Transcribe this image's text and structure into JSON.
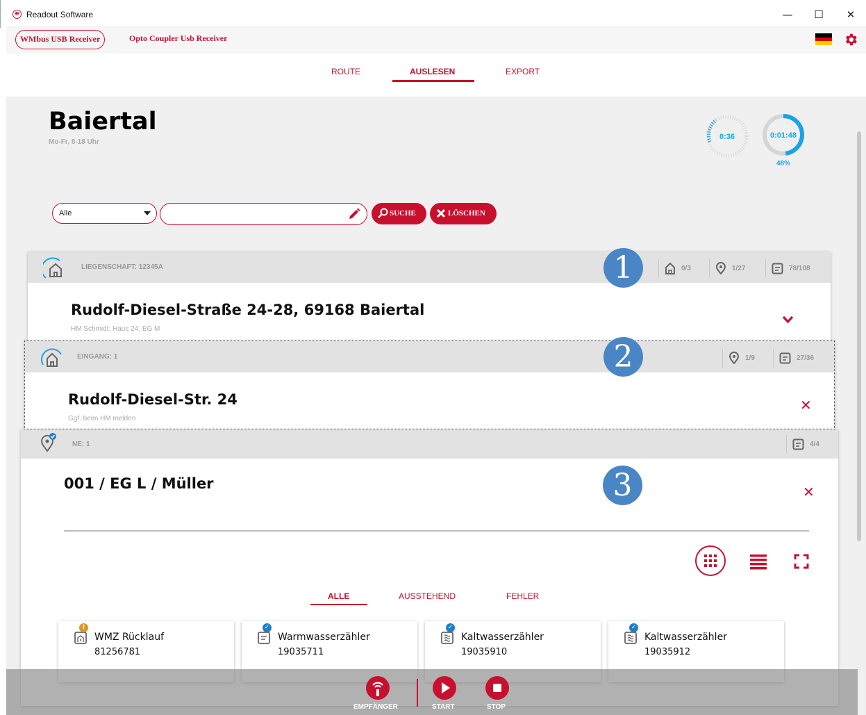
{
  "window": {
    "title": "Readout Software",
    "minimize": "—",
    "maximize": "☐",
    "close": "✕",
    "app_icon": "e"
  },
  "header": {
    "receiver_active": "WMbus USB Receiver",
    "receiver_other": "Opto Coupler Usb Receiver",
    "language_flag": "flag-de-icon",
    "settings_icon": "gear-icon"
  },
  "nav": {
    "tabs": [
      "ROUTE",
      "AUSLESEN",
      "EXPORT"
    ],
    "active": "AUSLESEN"
  },
  "location": {
    "title": "Baiertal",
    "hours": "Mo-Fr, 8-18 Uhr"
  },
  "timers": {
    "small": "0:36",
    "large": "0:01:48",
    "percent": "48%",
    "progress": 0.48
  },
  "search": {
    "filter_value": "Alle",
    "input_value": "",
    "search_label": "SUCHE",
    "clear_label": "LÖSCHEN"
  },
  "property": {
    "label": "LIEGENSCHAFT: 12345A",
    "badge": "1",
    "stat_buildings": "0/3",
    "stat_locations": "1/27",
    "stat_meters": "78/108",
    "address": "Rudolf-Diesel-Straße 24-28, 69168 Baiertal",
    "note": "HM Schmidt: Haus 24, EG M"
  },
  "entrance": {
    "label": "EINGANG: 1",
    "badge": "2",
    "stat_locations": "1/9",
    "stat_meters": "27/36",
    "address": "Rudolf-Diesel-Str. 24",
    "note": "Ggf. beim HM melden"
  },
  "unit": {
    "label": "NE: 1",
    "badge": "3",
    "stat_meters": "4/4",
    "title": "001 / EG L / Müller"
  },
  "meter_filter": {
    "tabs": [
      "ALLE",
      "AUSSTEHEND",
      "FEHLER"
    ],
    "active": "ALLE"
  },
  "meters": [
    {
      "name": "WMZ Rücklauf",
      "number": "81256781",
      "status": "warning",
      "status_glyph": "!",
      "status_color": "#e0952a",
      "icon": "heat-meter-icon"
    },
    {
      "name": "Warmwasserzähler",
      "number": "19035711",
      "status": "done",
      "status_glyph": "✓",
      "status_color": "#1f7fc8",
      "icon": "water-meter-icon"
    },
    {
      "name": "Kaltwasserzähler",
      "number": "19035910",
      "status": "done",
      "status_glyph": "✓",
      "status_color": "#1f7fc8",
      "icon": "water-meter-icon"
    },
    {
      "name": "Kaltwasserzähler",
      "number": "19035912",
      "status": "done",
      "status_glyph": "✓",
      "status_color": "#1f7fc8",
      "icon": "water-meter-icon"
    }
  ],
  "bottom": {
    "receiver": "EMPFÄNGER",
    "start": "START",
    "stop": "STOP"
  },
  "colors": {
    "accent": "#c8102e",
    "badge_blue": "#4a86c6",
    "timer_blue": "#1aa3e8"
  }
}
